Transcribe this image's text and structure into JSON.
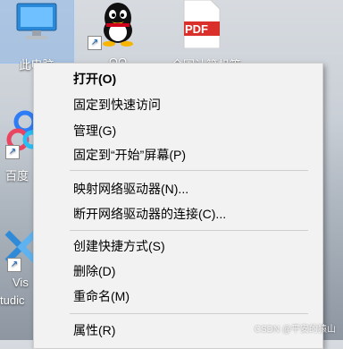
{
  "desktop": {
    "icons": [
      {
        "label": "此电脑"
      },
      {
        "label": "QQ"
      },
      {
        "label": "全国计算机等"
      },
      {
        "label": "百度"
      },
      {
        "label": "Vis"
      },
      {
        "label": "tudic"
      }
    ],
    "pdf_text": "PDF"
  },
  "context_menu": {
    "items": [
      {
        "label": "打开(O)"
      },
      {
        "label": "固定到快速访问"
      },
      {
        "label": "管理(G)"
      },
      {
        "label": "固定到“开始”屏幕(P)"
      },
      {
        "label": "映射网络驱动器(N)..."
      },
      {
        "label": "断开网络驱动器的连接(C)..."
      },
      {
        "label": "创建快捷方式(S)"
      },
      {
        "label": "删除(D)"
      },
      {
        "label": "重命名(M)"
      },
      {
        "label": "属性(R)"
      }
    ]
  },
  "watermark": "CSDN @平安的猿山"
}
